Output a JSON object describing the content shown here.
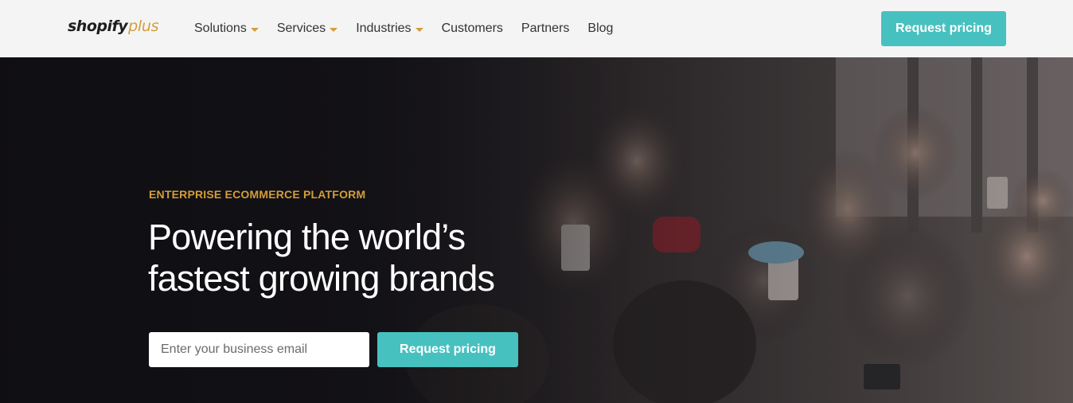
{
  "header": {
    "logo": {
      "primary": "shopify",
      "secondary": "plus"
    },
    "nav": [
      {
        "label": "Solutions",
        "dropdown": true
      },
      {
        "label": "Services",
        "dropdown": true
      },
      {
        "label": "Industries",
        "dropdown": true
      },
      {
        "label": "Customers",
        "dropdown": false
      },
      {
        "label": "Partners",
        "dropdown": false
      },
      {
        "label": "Blog",
        "dropdown": false
      }
    ],
    "cta_label": "Request pricing"
  },
  "hero": {
    "eyebrow": "ENTERPRISE ECOMMERCE PLATFORM",
    "headline_line1": "Powering the world’s",
    "headline_line2": "fastest growing brands",
    "email_placeholder": "Enter your business email",
    "cta_label": "Request pricing"
  },
  "colors": {
    "accent_teal": "#47c1bf",
    "accent_gold": "#d39d3b",
    "header_bg": "#f4f4f4",
    "hero_text": "#ffffff"
  }
}
